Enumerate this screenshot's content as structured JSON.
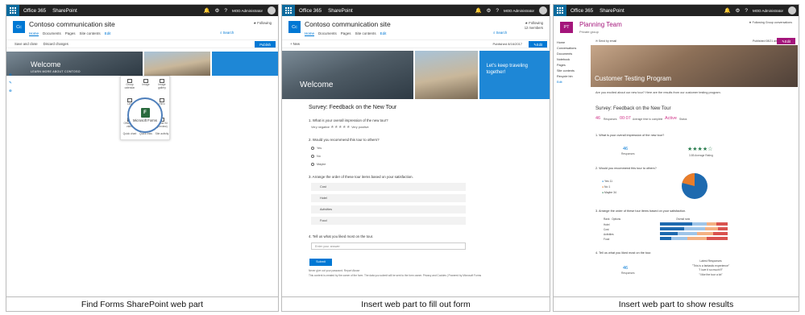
{
  "suite": {
    "app": "Office 365",
    "site": "SharePoint",
    "user": "MOD Administrator"
  },
  "icons": [
    "waffle-icon",
    "bell-icon",
    "gear-icon",
    "help-icon",
    "search-icon",
    "plus-icon",
    "forms-icon",
    "pencil-icon",
    "star-icon"
  ],
  "colors": {
    "accent": "#0078d4",
    "suite": "#222222",
    "planner": "#a4157b",
    "forms": "#2a6a3d",
    "orange": "#e97d2a"
  },
  "panel1": {
    "site_logo": "Cc",
    "site_title": "Contoso communication site",
    "nav": [
      "Home",
      "Documents",
      "Pages",
      "Site contents",
      "Edit"
    ],
    "following": "Following",
    "search": "Search",
    "toolbar": [
      "Save and close",
      "Discard changes"
    ],
    "publish": "Publish",
    "hero_welcome": "Welcome",
    "hero_link": "LEARN MORE ABOUT CONTOSO",
    "toolbox_items": [
      "Group calendar",
      "Image",
      "Image gallery",
      "Link",
      "List",
      "Hero",
      "Office 365 video",
      "People",
      "Power BI (preview)",
      "Quick chart",
      "Quick links",
      "Site activity"
    ],
    "highlight": "Microsoft Forms",
    "highlight_letter": "F"
  },
  "panel2": {
    "site_logo": "Cc",
    "site_title": "Contoso communication site",
    "nav": [
      "Home",
      "Documents",
      "Pages",
      "Site contents",
      "Edit"
    ],
    "following": "Following",
    "members": "12 members",
    "search": "Search",
    "toolbar_new": "New",
    "published": "Published 8/16/2017",
    "edit": "Edit",
    "hero_welcome": "Welcome",
    "promo": "Let's keep traveling together!",
    "form": {
      "title": "Survey: Feedback on the New Tour",
      "q1": "1. What is your overall impression of the new tour?",
      "q1_low": "Very negative",
      "q1_high": "Very positive",
      "q2": "2. Would you recommend this tour to others?",
      "q2_options": [
        "Yes",
        "No",
        "Maybe"
      ],
      "q3": "3. Arrange the order of these tour items based on your satisfaction.",
      "q3_items": [
        "Cost",
        "Hotel",
        "Activities",
        "Food"
      ],
      "q4": "4. Tell us what you liked most on the tour.",
      "q4_placeholder": "Enter your answer",
      "submit": "Submit",
      "footer1": "Never give out your password. Report Abuse",
      "footer2": "This content is created by the owner of the form. The data you submit will be sent to the form owner. Privacy and Cookies | Powered by Microsoft Forms"
    }
  },
  "panel3": {
    "group_logo": "PT",
    "group_title": "Planning Team",
    "group_type": "Private group",
    "following": "Following",
    "conversations": "Group conversations",
    "nav": [
      "Home",
      "Conversations",
      "Documents",
      "Notebook",
      "Pages",
      "Site contents",
      "Recycle bin",
      "Edit"
    ],
    "send_email": "Send by email",
    "published": "Published 08/21 am",
    "edit": "Edit",
    "hero_title": "Customer Testing Program",
    "intro": "Are you excited about our new tour? Here are the results from our customer testing program.",
    "form_title": "Survey: Feedback on the New Tour",
    "stats": [
      {
        "value": "46",
        "label": "Responses"
      },
      {
        "value": "00:07",
        "label": "Average time to complete"
      },
      {
        "value": "Active",
        "label": "Status"
      }
    ],
    "q1": "1. What is your overall impression of the new tour?",
    "q1_value": "46",
    "q1_value_label": "Responses",
    "q1_rating": "3.85 Average Rating",
    "q2": "2. Would you recommend this tour to others?",
    "q2_options": [
      "Yes",
      "No",
      "Maybe"
    ],
    "q2_counts": [
      "11",
      "1",
      "34"
    ],
    "q3": "3. Arrange the order of these tour items based on your satisfaction.",
    "q3_headers": [
      "Rank",
      "Options"
    ],
    "q3_legend": "Overall rank",
    "q3_items": [
      "Hotel",
      "Cost",
      "Activities",
      "Food"
    ],
    "q4": "4. Tell us what you liked most on the tour.",
    "q4_value": "46",
    "q4_value_label": "Responses",
    "q4_latest_label": "Latest Responses",
    "q4_responses": [
      "\"This is a fantastic experience\"",
      "\"I love it so much!!!\"",
      "\"I like the tour a lot\""
    ]
  },
  "captions": [
    "Find Forms SharePoint web part",
    "Insert web part to fill out form",
    "Insert web part to show results"
  ]
}
